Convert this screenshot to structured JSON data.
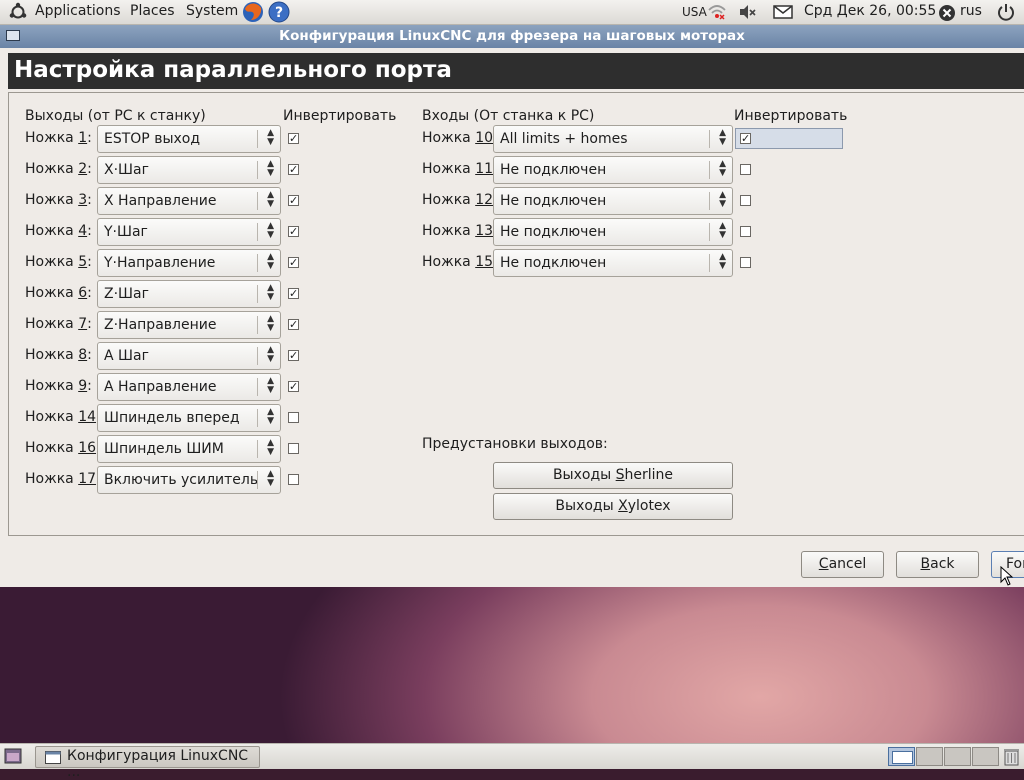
{
  "top_panel": {
    "applications": "Applications",
    "places": "Places",
    "system": "System",
    "keyboard_layout": "USA",
    "datetime": "Срд Дек 26, 00:55",
    "user": "rus"
  },
  "window": {
    "title": "Конфигурация LinuxCNC для фрезера на шаговых моторах",
    "header": "Настройка параллельного порта",
    "outputs_header": "Выходы (от PC к станку)",
    "outputs_invert_header": "Инвертировать",
    "inputs_header": "Входы (От станка к PC)",
    "inputs_invert_header": "Инвертировать",
    "outputs": [
      {
        "label_pre": "Ножка ",
        "key": "1",
        "value": "ESTOP выход",
        "inverted": true
      },
      {
        "label_pre": "Ножка ",
        "key": "2",
        "value": "X·Шаг",
        "inverted": true
      },
      {
        "label_pre": "Ножка ",
        "key": "3",
        "value": "X Направление",
        "inverted": true
      },
      {
        "label_pre": "Ножка ",
        "key": "4",
        "value": "Y·Шаг",
        "inverted": true
      },
      {
        "label_pre": "Ножка ",
        "key": "5",
        "value": "Y·Направление",
        "inverted": true
      },
      {
        "label_pre": "Ножка ",
        "key": "6",
        "value": "Z·Шаг",
        "inverted": true
      },
      {
        "label_pre": "Ножка ",
        "key": "7",
        "value": "Z·Направление",
        "inverted": true
      },
      {
        "label_pre": "Ножка ",
        "key": "8",
        "value": "A Шаг",
        "inverted": true
      },
      {
        "label_pre": "Ножка ",
        "key": "9",
        "value": "A Направление",
        "inverted": true
      },
      {
        "label_pre": "Ножка ",
        "key": "14",
        "value": "Шпиндель вперед",
        "inverted": false
      },
      {
        "label_pre": "Ножка ",
        "key": "16",
        "value": "Шпиндель ШИМ",
        "inverted": false
      },
      {
        "label_pre": "Ножка ",
        "key": "17",
        "value": "Включить усилитель",
        "inverted": false
      }
    ],
    "inputs": [
      {
        "label_pre": "Ножка ",
        "key": "10",
        "value": "All limits + homes",
        "inverted": true
      },
      {
        "label_pre": "Ножка ",
        "key": "11",
        "value": "Не подключен",
        "inverted": false
      },
      {
        "label_pre": "Ножка ",
        "key": "12",
        "value": "Не подключен",
        "inverted": false
      },
      {
        "label_pre": "Ножка ",
        "key": "13",
        "value": "Не подключен",
        "inverted": false
      },
      {
        "label_pre": "Ножка ",
        "key": "15",
        "value": "Не подключен",
        "inverted": false
      }
    ],
    "presets_label": "Предустановки выходов:",
    "preset_sherline": {
      "pre": "Выходы ",
      "key": "S",
      "post": "herline"
    },
    "preset_xylotex": {
      "pre": "Выходы ",
      "key": "X",
      "post": "ylotex"
    },
    "cancel": {
      "key": "C",
      "post": "ancel"
    },
    "back": {
      "key": "B",
      "post": "ack"
    },
    "forward_partial": "For"
  },
  "taskbar": {
    "task_label": "Конфигурация LinuxCNC ..."
  }
}
